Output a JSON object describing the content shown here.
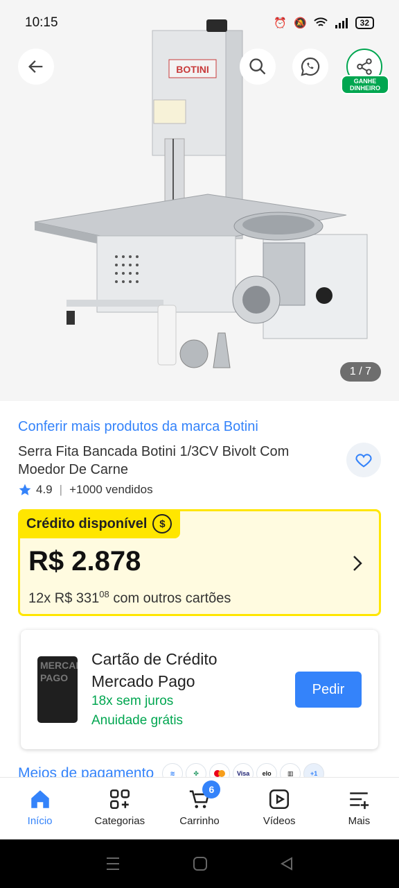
{
  "status_bar": {
    "time": "10:15",
    "battery": "32"
  },
  "gallery": {
    "counter": "1 / 7",
    "share_badge": "GANHE DINHEIRO",
    "product_brand": "BOTINI"
  },
  "product": {
    "brand_link": "Conferir mais produtos da marca Botini",
    "title": "Serra Fita Bancada Botini 1/3CV Bivolt Com Moedor De Carne",
    "rating": "4.9",
    "sold": "+1000 vendidos"
  },
  "credit": {
    "tag": "Crédito disponível",
    "coin": "$",
    "price": "R$ 2.878",
    "installments_prefix": "12x R$ 331",
    "installments_cents": "08",
    "installments_suffix": " com outros cartões"
  },
  "card_offer": {
    "title": "Cartão de Crédito Mercado Pago",
    "line1": "18x sem juros",
    "line2": "Anuidade grátis",
    "button": "Pedir",
    "card_text": "MERCADO PAGO"
  },
  "payment": {
    "label": "Meios de pagamento",
    "logos": [
      "Visa",
      "elo",
      "+1"
    ]
  },
  "bottom_nav": {
    "home": "Início",
    "categories": "Categorias",
    "cart": "Carrinho",
    "cart_count": "6",
    "videos": "Vídeos",
    "more": "Mais"
  },
  "colors": {
    "accent": "#3483fa",
    "yellow": "#ffe600",
    "green": "#00a650"
  }
}
